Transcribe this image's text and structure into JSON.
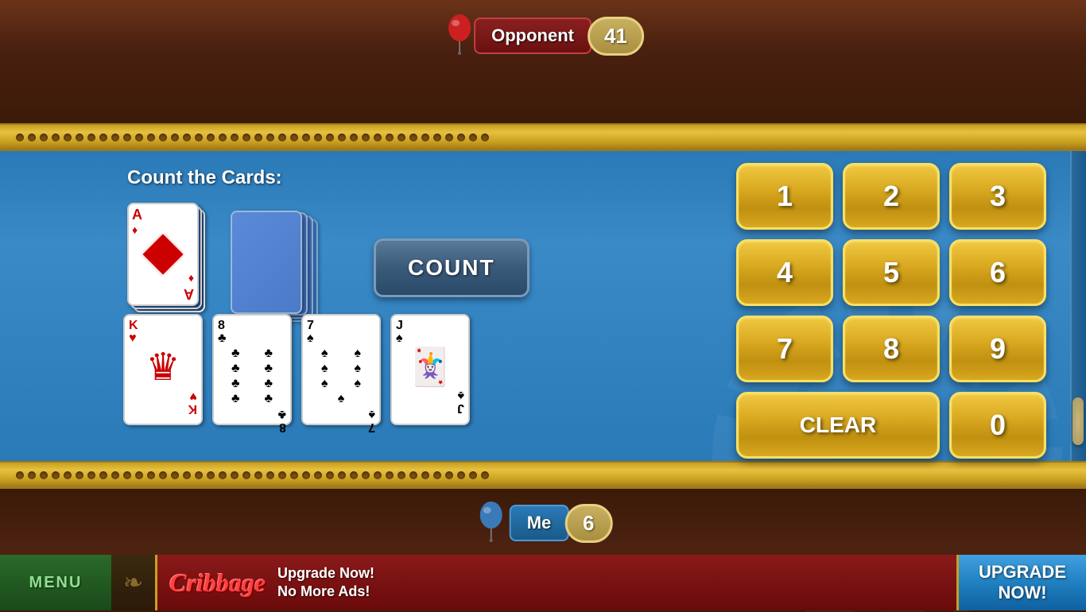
{
  "game": {
    "title": "Cribbage",
    "opponent": {
      "label": "Opponent",
      "score": "41"
    },
    "player": {
      "label": "Me",
      "score": "6"
    }
  },
  "ui": {
    "count_instruction": "Count the Cards:",
    "count_button": "COUNT",
    "clear_button": "CLEAR",
    "menu_button": "MENU",
    "upgrade_button": "UPGRADE\nNOW!",
    "ad_logo": "Cribbage",
    "ad_text_line1": "Upgrade Now!",
    "ad_text_line2": "No More Ads!"
  },
  "numpad": {
    "buttons": [
      "1",
      "2",
      "3",
      "4",
      "5",
      "6",
      "7",
      "8",
      "9",
      "CLEAR",
      "0"
    ]
  },
  "cards": {
    "top_card": {
      "rank": "A",
      "suit": "♦",
      "color": "red"
    },
    "hand": [
      {
        "rank": "K",
        "suit": "♥",
        "color": "red"
      },
      {
        "rank": "8",
        "suit": "♣",
        "color": "black"
      },
      {
        "rank": "7",
        "suit": "♠",
        "color": "black"
      },
      {
        "rank": "J",
        "suit": "♠",
        "color": "black"
      }
    ]
  },
  "colors": {
    "gold": "#d4a020",
    "blue_game": "#3a8ac8",
    "wood": "#4a2010"
  }
}
